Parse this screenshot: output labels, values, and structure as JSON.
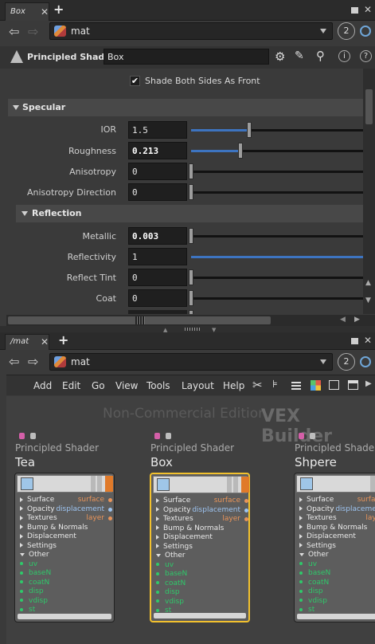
{
  "top_panel": {
    "tab_label": "Box",
    "path_label": "mat",
    "link_count": "2"
  },
  "param_header": {
    "node_type": "Principled Shader",
    "node_name": "Box"
  },
  "params": {
    "shade_both_sides": {
      "label": "Shade Both Sides As Front",
      "checked": true
    },
    "specular": {
      "section": "Specular",
      "ior": {
        "label": "IOR",
        "value": "1.5",
        "slider": 0.39
      },
      "roughness": {
        "label": "Roughness",
        "value": "0.213",
        "slider": 0.29
      },
      "anisotropy": {
        "label": "Anisotropy",
        "value": "0",
        "slider": 0.0
      },
      "aniso_dir": {
        "label": "Anisotropy Direction",
        "value": "0",
        "slider": 0.0
      }
    },
    "reflection": {
      "section": "Reflection",
      "metallic": {
        "label": "Metallic",
        "value": "0.003",
        "slider": 0.0
      },
      "reflectivity": {
        "label": "Reflectivity",
        "value": "1",
        "slider": 1.0
      },
      "reflect_tint": {
        "label": "Reflect Tint",
        "value": "0",
        "slider": 0.0
      },
      "coat": {
        "label": "Coat",
        "value": "0",
        "slider": 0.0
      }
    }
  },
  "bottom_panel": {
    "tab_label": "/mat",
    "path_label": "mat",
    "link_count": "2",
    "menu": [
      "Add",
      "Edit",
      "Go",
      "View",
      "Tools",
      "Layout",
      "Help"
    ],
    "watermark": "Non-Commercial Edition",
    "context_label": "VEX Builder"
  },
  "nodes": [
    {
      "type": "Principled Shader",
      "name": "Tea",
      "selected": false
    },
    {
      "type": "Principled Shader",
      "name": "Box",
      "selected": true
    },
    {
      "type": "Principled Shade",
      "name": "Shpere",
      "selected": false
    }
  ],
  "node_inputs": [
    "Surface",
    "Opacity",
    "Textures",
    "Bump & Normals",
    "Displacement",
    "Settings",
    "Other"
  ],
  "node_outputs": [
    "surface",
    "displacement",
    "layer"
  ],
  "node_other": [
    "uv",
    "baseN",
    "coatN",
    "disp",
    "vdisp",
    "st"
  ],
  "colors": {
    "slider_fill": "#3d74c0",
    "selected_outline": "#f2c12e",
    "output_port": "#e8945a",
    "displacement_port": "#9cc3f0",
    "other_port": "#2fc86a",
    "badge_pink": "#d45fa8"
  }
}
